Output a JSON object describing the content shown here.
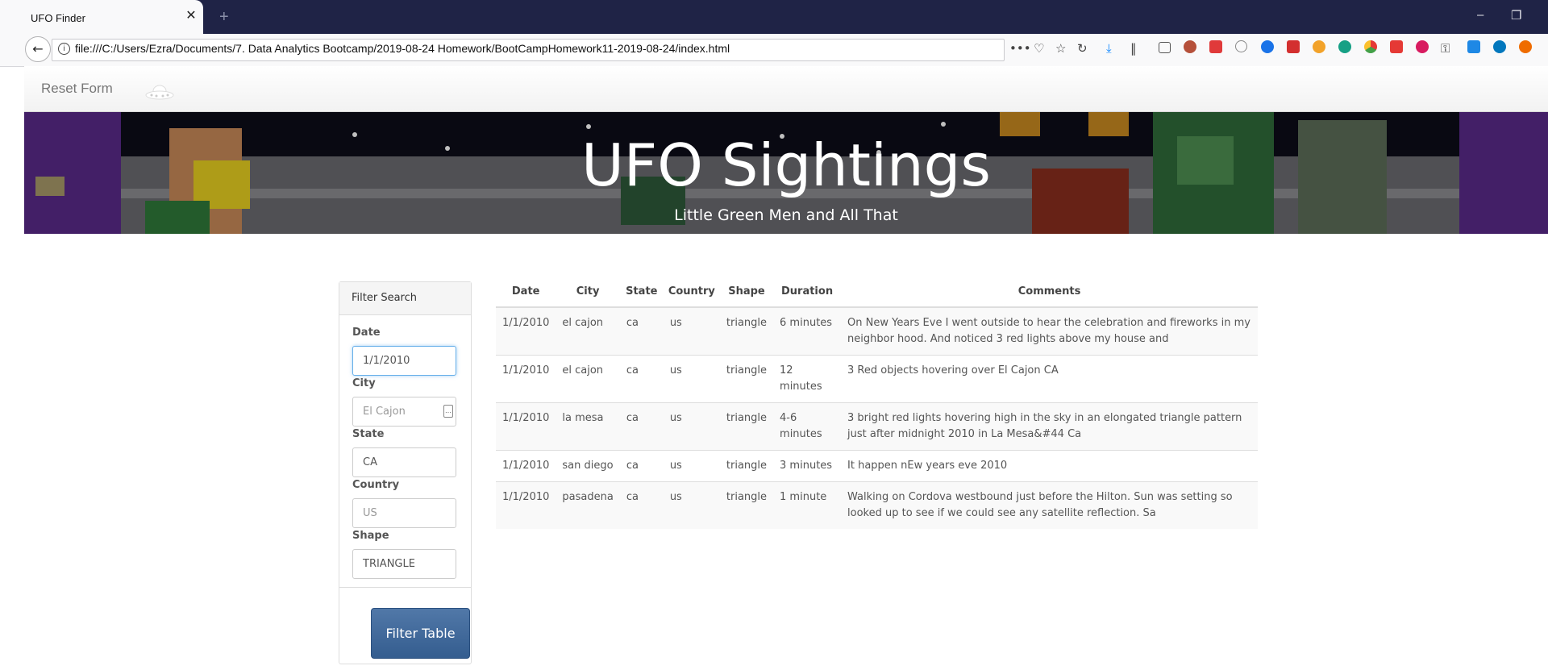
{
  "browser": {
    "tab_title": "UFO Finder",
    "tab_close": "✕",
    "new_tab": "+",
    "url": "file:///C:/Users/Ezra/Documents/7. Data Analytics Bootcamp/2019-08-24 Homework/BootCampHomework11-2019-08-24/index.html",
    "page_actions": "•••"
  },
  "nav": {
    "reset_label": "Reset Form"
  },
  "hero": {
    "title": "UFO Sightings",
    "subtitle": "Little Green Men and All That"
  },
  "filter": {
    "heading": "Filter Search",
    "fields": [
      {
        "label": "Date",
        "value": "1/1/2010",
        "placeholder": ""
      },
      {
        "label": "City",
        "value": "",
        "placeholder": "El Cajon"
      },
      {
        "label": "State",
        "value": "CA",
        "placeholder": ""
      },
      {
        "label": "Country",
        "value": "",
        "placeholder": "US"
      },
      {
        "label": "Shape",
        "value": "TRIANGLE",
        "placeholder": ""
      }
    ],
    "button_label": "Filter Table"
  },
  "table": {
    "headers": [
      "Date",
      "City",
      "State",
      "Country",
      "Shape",
      "Duration",
      "Comments"
    ],
    "rows": [
      [
        "1/1/2010",
        "el cajon",
        "ca",
        "us",
        "triangle",
        "6 minutes",
        "On New Years Eve I went outside to hear the celebration and fireworks in my neighbor hood. And noticed 3 red lights above my house and"
      ],
      [
        "1/1/2010",
        "el cajon",
        "ca",
        "us",
        "triangle",
        "12 minutes",
        "3 Red objects hovering over El Cajon CA"
      ],
      [
        "1/1/2010",
        "la mesa",
        "ca",
        "us",
        "triangle",
        "4-6 minutes",
        "3 bright red lights hovering high in the sky in an elongated triangle pattern just after midnight 2010 in La Mesa&#44 Ca"
      ],
      [
        "1/1/2010",
        "san diego",
        "ca",
        "us",
        "triangle",
        "3 minutes",
        "It happen nEw years eve 2010"
      ],
      [
        "1/1/2010",
        "pasadena",
        "ca",
        "us",
        "triangle",
        "1 minute",
        "Walking on Cordova westbound just before the Hilton. Sun was setting so looked up to see if we could see any satellite reflection. Sa"
      ]
    ]
  },
  "colors": {
    "hero_bg": "#4a4a52",
    "button": "#345d8f",
    "tabbar": "#1f2346"
  }
}
